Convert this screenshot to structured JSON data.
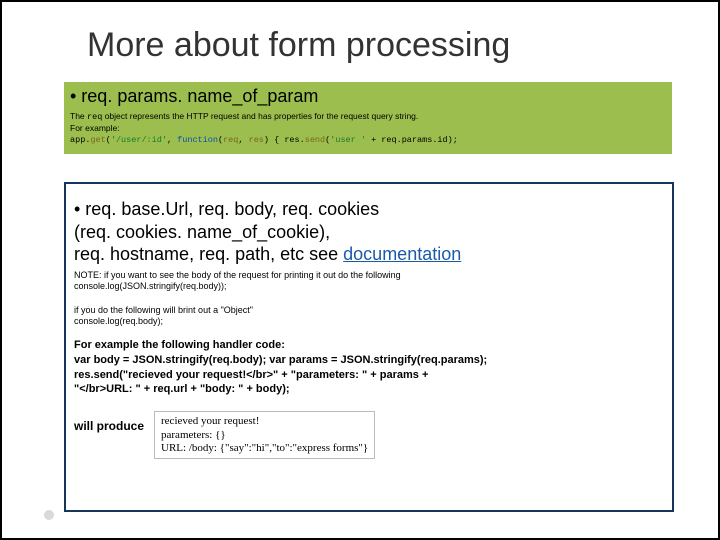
{
  "title": "More about form processing",
  "green": {
    "bullet": "• req. params. name_of_param",
    "desc_pre": "The ",
    "desc_mono": "req",
    "desc_post": " object represents the HTTP request and has properties for the request query string.",
    "for_example": "For example:",
    "code": {
      "s1": "app",
      "s2": ".",
      "s3": "get",
      "s4": "(",
      "s5": "'/user/:id'",
      "s6": ", ",
      "s7": "function",
      "s8": "(",
      "s9": "req",
      "s10": ", ",
      "s11": "res",
      "s12": ") { ",
      "s13": "res",
      "s14": ".",
      "s15": "send",
      "s16": "(",
      "s17": "'user '",
      "s18": " + ",
      "s19": "req",
      "s20": ".",
      "s21": "params",
      "s22": ".",
      "s23": "id",
      "s24": ");"
    }
  },
  "white": {
    "line1": "• req. base.Url, req. body, req. cookies",
    "line2": "(req. cookies. name_of_cookie),",
    "line3_pre": " req. hostname, req. path, etc see ",
    "line3_link": "documentation",
    "note1": "NOTE: if you want to see the body of the request for printing it out do the following",
    "note2": "console.log(JSON.stringify(req.body));",
    "note3": "if you do the following will brint out a \"Object\"",
    "note4": "console.log(req.body);",
    "h1": "For example the following handler code:",
    "h2": " var body = JSON.stringify(req.body);  var params = JSON.stringify(req.params);",
    "h3": "res.send(\"recieved your request!</br>\" + \"parameters: \" + params +",
    "h4": "                  \"</br>URL: \" + req.url + \"body: \" + body);",
    "produce": "will produce",
    "out1": "recieved your request!",
    "out2": "parameters: {}",
    "out3": "URL: /body: {\"say\":\"hi\",\"to\":\"express forms\"}"
  }
}
